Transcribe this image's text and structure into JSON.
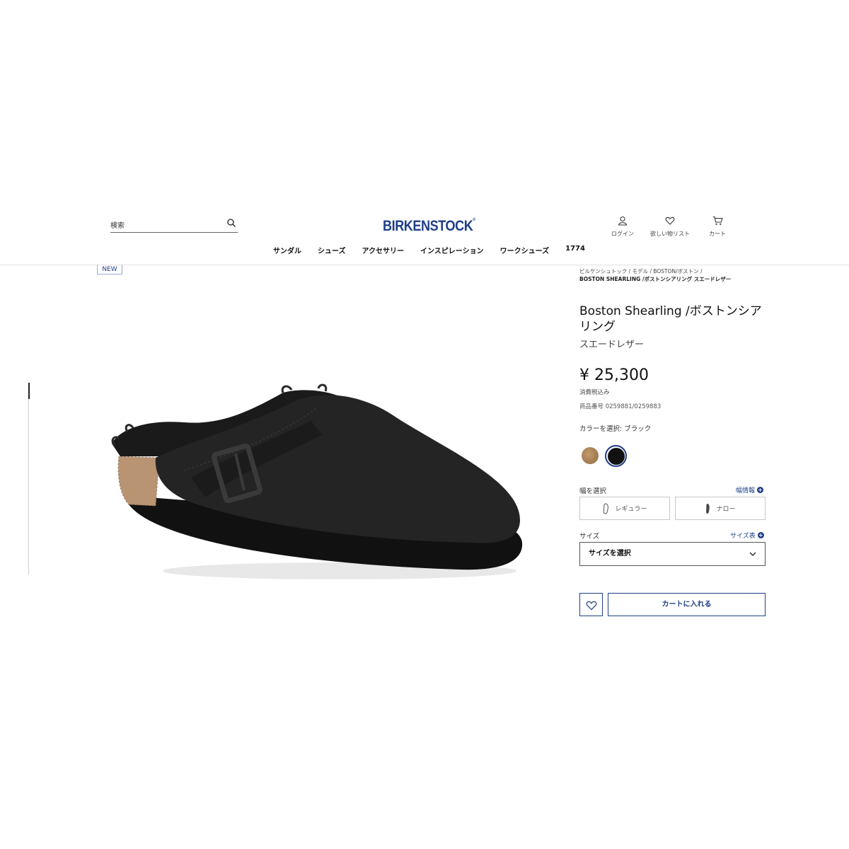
{
  "header": {
    "search_placeholder": "検索",
    "logo": "BIRKENSTOCK",
    "account": {
      "login": "ログイン",
      "wishlist": "欲しい物リスト",
      "cart": "カート"
    },
    "nav": [
      "サンダル",
      "シューズ",
      "アクセサリー",
      "インスピレーション",
      "ワークシューズ",
      "1774"
    ]
  },
  "product": {
    "badge": "NEW",
    "breadcrumb": {
      "line1": "ビルケンシュトック / モデル / BOSTON/ボストン /",
      "line2": "BOSTON SHEARLING /ボストンシアリング スエードレザー"
    },
    "title": "Boston Shearling /ボストンシアリング",
    "material": "スエードレザー",
    "price": "¥ 25,300",
    "tax_note": "消費税込み",
    "sku": "商品番号 0259881/0259883",
    "color_label": "カラーを選択: ブラック",
    "colors": [
      {
        "name": "cork",
        "hex": "#a57c52"
      },
      {
        "name": "black",
        "hex": "#111111",
        "selected": true
      }
    ],
    "width_label": "幅を選択",
    "width_info": "幅情報",
    "width_options": [
      "レギュラー",
      "ナロー"
    ],
    "size_label": "サイズ",
    "size_chart": "サイズ表",
    "size_select": "サイズを選択",
    "add_to_cart": "カートに入れる"
  },
  "colors": {
    "brand": "#1f3f87"
  }
}
